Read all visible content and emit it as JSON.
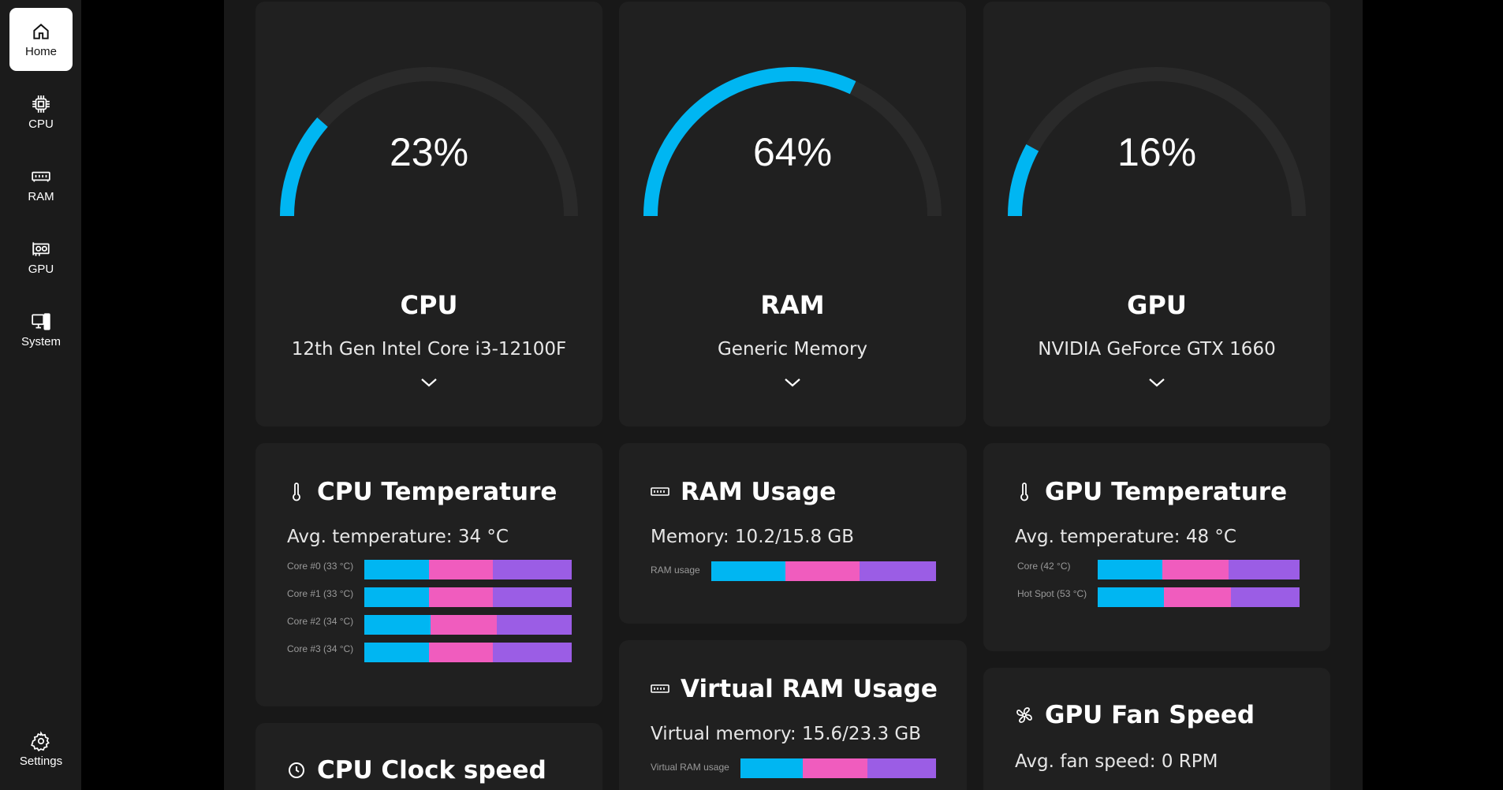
{
  "sidebar": {
    "items": [
      {
        "label": "Home",
        "icon": "home-icon",
        "active": true
      },
      {
        "label": "CPU",
        "icon": "cpu-icon"
      },
      {
        "label": "RAM",
        "icon": "ram-icon"
      },
      {
        "label": "GPU",
        "icon": "gpu-icon"
      },
      {
        "label": "System",
        "icon": "system-icon"
      }
    ],
    "settings": {
      "label": "Settings",
      "icon": "gear-icon"
    }
  },
  "colors": {
    "accent": "#00b6f2",
    "pink": "#f05cbe",
    "purple": "#9b5de5",
    "card": "#202020"
  },
  "gauges": {
    "cpu": {
      "value": 23,
      "percent_text": "23%",
      "title": "CPU",
      "subtitle": "12th Gen Intel Core i3-12100F"
    },
    "ram": {
      "value": 64,
      "percent_text": "64%",
      "title": "RAM",
      "subtitle": "Generic Memory"
    },
    "gpu": {
      "value": 16,
      "percent_text": "16%",
      "title": "GPU",
      "subtitle": "NVIDIA GeForce GTX 1660"
    }
  },
  "cpu_temp": {
    "title": "CPU Temperature",
    "summary": "Avg. temperature: 34 °C",
    "rows": [
      {
        "label": "Core #0 (33 °C)",
        "segments": [
          0.31,
          0.31,
          0.38
        ]
      },
      {
        "label": "Core #1 (33 °C)",
        "segments": [
          0.31,
          0.31,
          0.38
        ]
      },
      {
        "label": "Core #2 (34 °C)",
        "segments": [
          0.32,
          0.32,
          0.36
        ]
      },
      {
        "label": "Core #3 (34 °C)",
        "segments": [
          0.31,
          0.31,
          0.38
        ]
      }
    ]
  },
  "ram_usage": {
    "title": "RAM Usage",
    "summary": "Memory: 10.2/15.8 GB",
    "rows": [
      {
        "label": "RAM usage",
        "segments": [
          0.33,
          0.33,
          0.34
        ]
      }
    ]
  },
  "gpu_temp": {
    "title": "GPU Temperature",
    "summary": "Avg. temperature: 48 °C",
    "rows": [
      {
        "label": "Core (42 °C)",
        "segments": [
          0.32,
          0.33,
          0.35
        ]
      },
      {
        "label": "Hot Spot (53 °C)",
        "segments": [
          0.33,
          0.33,
          0.34
        ]
      }
    ]
  },
  "vram_usage": {
    "title": "Virtual RAM Usage",
    "summary": "Virtual memory: 15.6/23.3 GB",
    "rows": [
      {
        "label": "Virtual RAM usage",
        "segments": [
          0.32,
          0.33,
          0.35
        ]
      }
    ]
  },
  "cpu_clock": {
    "title": "CPU Clock speed"
  },
  "gpu_fan": {
    "title": "GPU Fan Speed",
    "summary": "Avg. fan speed: 0 RPM"
  }
}
